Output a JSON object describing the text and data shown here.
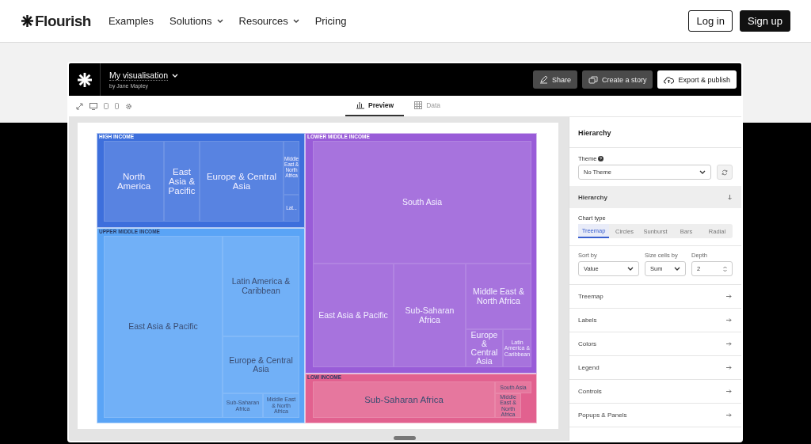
{
  "site_nav": {
    "logo": "Flourish",
    "items": [
      {
        "label": "Examples",
        "dropdown": false
      },
      {
        "label": "Solutions",
        "dropdown": true
      },
      {
        "label": "Resources",
        "dropdown": true
      },
      {
        "label": "Pricing",
        "dropdown": false
      }
    ],
    "buttons": [
      {
        "label": "Log in",
        "kind": "outline"
      },
      {
        "label": "Sign up",
        "kind": "solid"
      }
    ]
  },
  "editor": {
    "title": "My visualisation",
    "author": "by Jane Mapley",
    "actions": [
      {
        "label": "Share",
        "kind": "dark"
      },
      {
        "label": "Create a story",
        "kind": "dark"
      },
      {
        "label": "Export & publish",
        "kind": "light"
      }
    ],
    "view_tabs": [
      {
        "label": "Preview",
        "selected": true
      },
      {
        "label": "Data",
        "selected": false
      }
    ]
  },
  "treemap": {
    "groups": [
      {
        "label": "HIGH INCOME",
        "color": "#3d6fdc",
        "cells": [
          {
            "label": "North America"
          },
          {
            "label": "East Asia & Pacific"
          },
          {
            "label": "Europe & Central Asia"
          },
          {
            "label": "Middle East & North Africa"
          },
          {
            "label": "Lat..."
          }
        ]
      },
      {
        "label": "UPPER MIDDLE INCOME",
        "color": "#5aa4f6",
        "cells": [
          {
            "label": "East Asia & Pacific"
          },
          {
            "label": "Latin America & Caribbean"
          },
          {
            "label": "Europe & Central Asia"
          },
          {
            "label": "Sub-Saharan Africa"
          },
          {
            "label": "Middle East & North Africa"
          }
        ]
      },
      {
        "label": "LOWER MIDDLE INCOME",
        "color": "#995cd8",
        "cells": [
          {
            "label": "South Asia"
          },
          {
            "label": "East Asia & Pacific"
          },
          {
            "label": "Sub-Saharan Africa"
          },
          {
            "label": "Middle East & North Africa"
          },
          {
            "label": "Europe & Central Asia"
          },
          {
            "label": "Latin America & Caribbean"
          }
        ]
      },
      {
        "label": "LOW INCOME",
        "color": "#e2618f",
        "cells": [
          {
            "label": "Sub-Saharan Africa"
          },
          {
            "label": "South Asia"
          },
          {
            "label": "Middle East & North Africa"
          }
        ]
      }
    ]
  },
  "settings": {
    "title": "Hierarchy",
    "theme": {
      "label": "Theme",
      "value": "No Theme"
    },
    "section": {
      "label": "Hierarchy",
      "expanded": true
    },
    "chart_type": {
      "label": "Chart type",
      "options": [
        {
          "label": "Treemap",
          "selected": true
        },
        {
          "label": "Circles",
          "selected": false
        },
        {
          "label": "Sunburst",
          "selected": false
        },
        {
          "label": "Bars",
          "selected": false
        },
        {
          "label": "Radial",
          "selected": false
        }
      ]
    },
    "fields": [
      {
        "label": "Sort by",
        "value": "Value",
        "kind": "select"
      },
      {
        "label": "Size cells by",
        "value": "Sum",
        "kind": "select"
      },
      {
        "label": "Depth",
        "value": "2",
        "kind": "number"
      }
    ],
    "panels": [
      {
        "label": "Treemap"
      },
      {
        "label": "Labels"
      },
      {
        "label": "Colors"
      },
      {
        "label": "Legend"
      },
      {
        "label": "Controls"
      },
      {
        "label": "Popups & Panels"
      }
    ]
  }
}
